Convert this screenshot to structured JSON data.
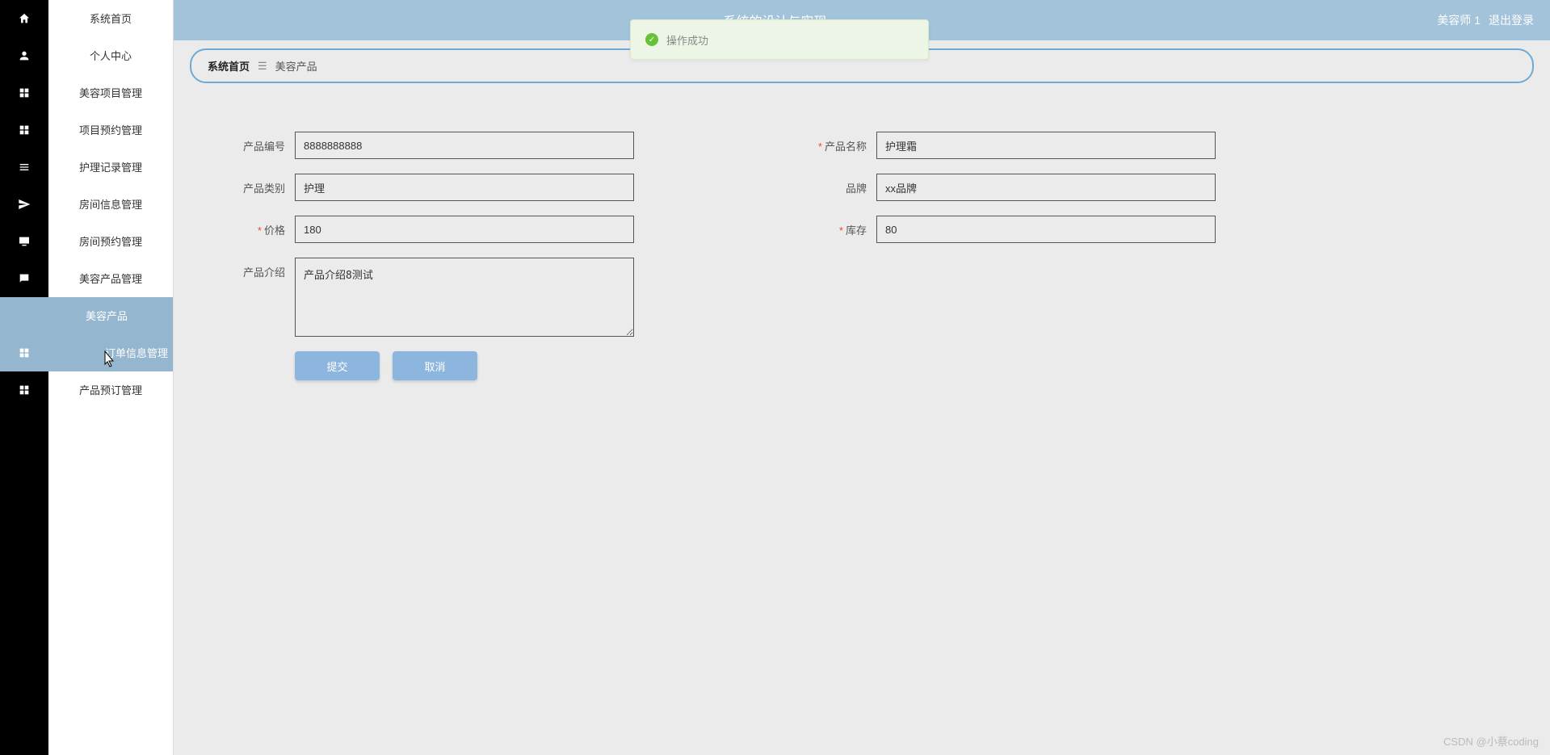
{
  "header": {
    "title_suffix": "系统的设计与实现",
    "user": "美容师 1",
    "logout": "退出登录"
  },
  "toast": {
    "text": "操作成功"
  },
  "sidebar": {
    "items": [
      {
        "label": "系统首页"
      },
      {
        "label": "个人中心"
      },
      {
        "label": "美容项目管理"
      },
      {
        "label": "项目预约管理"
      },
      {
        "label": "护理记录管理"
      },
      {
        "label": "房间信息管理"
      },
      {
        "label": "房间预约管理"
      },
      {
        "label": "美容产品管理"
      },
      {
        "label": "美容产品"
      },
      {
        "label": "订单信息管理"
      },
      {
        "label": "产品预订管理"
      }
    ]
  },
  "breadcrumb": {
    "home": "系统首页",
    "current": "美容产品"
  },
  "form": {
    "product_code_label": "产品编号",
    "product_code_value": "8888888888",
    "product_name_label": "产品名称",
    "product_name_value": "护理霜",
    "category_label": "产品类别",
    "category_value": "护理",
    "brand_label": "品牌",
    "brand_value": "xx品牌",
    "price_label": "价格",
    "price_value": "180",
    "stock_label": "库存",
    "stock_value": "80",
    "intro_label": "产品介绍",
    "intro_value": "产品介绍8测试",
    "submit": "提交",
    "cancel": "取消"
  },
  "watermark": "CSDN @小蔡coding"
}
